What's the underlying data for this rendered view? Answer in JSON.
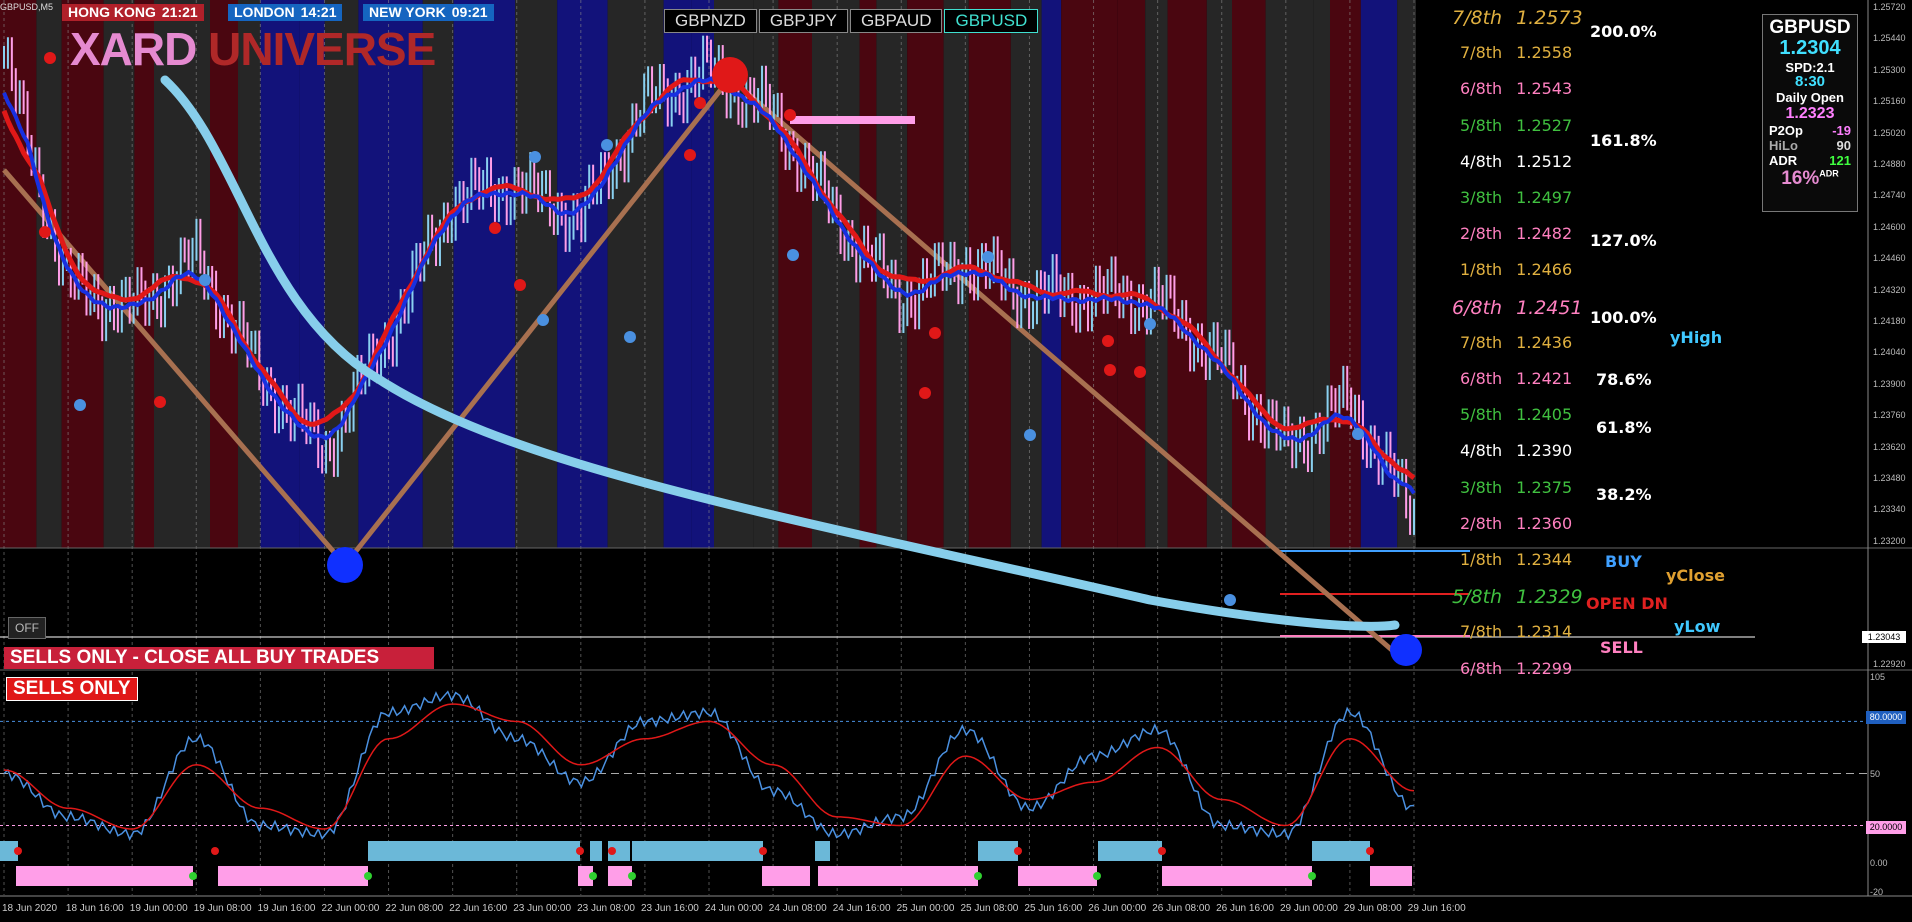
{
  "chart_symbol": "GBPUSD,M5",
  "sessions": [
    {
      "name": "HONG KONG",
      "time": "21:21",
      "bg": "#b0202a"
    },
    {
      "name": "LONDON",
      "time": "14:21",
      "bg": "#1565c0"
    },
    {
      "name": "NEW YORK",
      "time": "09:21",
      "bg": "#1565c0"
    }
  ],
  "logo": {
    "left": "XARD",
    "right": "UNIVERSE"
  },
  "symbol_tabs": [
    {
      "label": "GBPNZD",
      "active": false
    },
    {
      "label": "GBPJPY",
      "active": false
    },
    {
      "label": "GBPAUD",
      "active": false
    },
    {
      "label": "GBPUSD",
      "active": true
    }
  ],
  "info_box": {
    "symbol": "GBPUSD",
    "price": "1.2304",
    "spread": "SPD:2.1",
    "countdown": "8:30",
    "daily_open_label": "Daily Open",
    "daily_open": "1.2323",
    "p2op_label": "P2Op",
    "p2op": "-19",
    "hilo_label": "HiLo",
    "hilo": "90",
    "adr_label": "ADR",
    "adr": "121",
    "adr_pct": "16%",
    "adr_pct_sup": "ADR"
  },
  "murrey_levels": [
    {
      "label": "7/8th",
      "price": "1.2573",
      "color": "#e0b040",
      "italic": true
    },
    {
      "label": "7/8th",
      "price": "1.2558",
      "color": "#e0b040",
      "italic": false
    },
    {
      "label": "6/8th",
      "price": "1.2543",
      "color": "#ff80c0",
      "italic": false
    },
    {
      "label": "5/8th",
      "price": "1.2527",
      "color": "#40c040",
      "italic": false
    },
    {
      "label": "4/8th",
      "price": "1.2512",
      "color": "#ffffff",
      "italic": false
    },
    {
      "label": "3/8th",
      "price": "1.2497",
      "color": "#40c040",
      "italic": false
    },
    {
      "label": "2/8th",
      "price": "1.2482",
      "color": "#ff80c0",
      "italic": false
    },
    {
      "label": "1/8th",
      "price": "1.2466",
      "color": "#e0b040",
      "italic": false
    },
    {
      "label": "6/8th",
      "price": "1.2451",
      "color": "#ff80c0",
      "italic": true
    },
    {
      "label": "7/8th",
      "price": "1.2436",
      "color": "#e0b040",
      "italic": false
    },
    {
      "label": "6/8th",
      "price": "1.2421",
      "color": "#ff80c0",
      "italic": false
    },
    {
      "label": "5/8th",
      "price": "1.2405",
      "color": "#40c040",
      "italic": false
    },
    {
      "label": "4/8th",
      "price": "1.2390",
      "color": "#ffffff",
      "italic": false
    },
    {
      "label": "3/8th",
      "price": "1.2375",
      "color": "#40c040",
      "italic": false
    },
    {
      "label": "2/8th",
      "price": "1.2360",
      "color": "#ff80c0",
      "italic": false
    },
    {
      "label": "1/8th",
      "price": "1.2344",
      "color": "#e0b040",
      "italic": false
    },
    {
      "label": "5/8th",
      "price": "1.2329",
      "color": "#40c040",
      "italic": true
    },
    {
      "label": "7/8th",
      "price": "1.2314",
      "color": "#e0b040",
      "italic": false
    },
    {
      "label": "6/8th",
      "price": "1.2299",
      "color": "#ff80c0",
      "italic": false
    }
  ],
  "fib_levels": [
    "200.0%",
    "161.8%",
    "127.0%",
    "100.0%",
    "78.6%",
    "61.8%",
    "38.2%"
  ],
  "markers": {
    "yhigh": "yHigh",
    "buy": "BUY",
    "yclose": "yClose",
    "open_dn": "OPEN DN",
    "ylow": "yLow",
    "sell": "SELL"
  },
  "off_button": "OFF",
  "banners": {
    "main": "SELLS ONLY - CLOSE ALL BUY TRADES",
    "sub": "SELLS ONLY"
  },
  "price_axis": [
    "1.25720",
    "1.25440",
    "1.25300",
    "1.25160",
    "1.25020",
    "1.24880",
    "1.24740",
    "1.24600",
    "1.24460",
    "1.24320",
    "1.24180",
    "1.24040",
    "1.23900",
    "1.23760",
    "1.23620",
    "1.23480",
    "1.23340",
    "1.23200",
    "1.23043",
    "1.22920"
  ],
  "current_price_tag": "1.23043",
  "indicator_axis": {
    "top": "105",
    "level80": "80.0000",
    "mid": "50",
    "level20": "20.0000",
    "zero": "0.00",
    "bottom": "-20"
  },
  "time_axis": [
    "18 Jun 2020",
    "18 Jun 16:00",
    "19 Jun 00:00",
    "19 Jun 08:00",
    "19 Jun 16:00",
    "22 Jun 00:00",
    "22 Jun 08:00",
    "22 Jun 16:00",
    "23 Jun 00:00",
    "23 Jun 08:00",
    "23 Jun 16:00",
    "24 Jun 00:00",
    "24 Jun 08:00",
    "24 Jun 16:00",
    "25 Jun 00:00",
    "25 Jun 08:00",
    "25 Jun 16:00",
    "26 Jun 00:00",
    "26 Jun 08:00",
    "26 Jun 16:00",
    "29 Jun 00:00",
    "29 Jun 08:00",
    "29 Jun 16:00"
  ],
  "colors": {
    "up_band": "#12127a",
    "down_band": "#4a0610",
    "neutral_band": "#262626",
    "red_ma": "#e01818",
    "blue_ma": "#1830e0",
    "trend_line": "#a87050",
    "long_ma": "#87ceeb",
    "stoch_blue": "#4a90e0",
    "stoch_red": "#e01818",
    "bar_sky": "#6bb8d8",
    "bar_pink": "#ff9ee8"
  },
  "chart_data": {
    "type": "line",
    "x": [
      "18 Jun 2020",
      "18 Jun 16:00",
      "19 Jun 00:00",
      "19 Jun 08:00",
      "19 Jun 16:00",
      "22 Jun 00:00",
      "22 Jun 08:00",
      "22 Jun 16:00",
      "23 Jun 00:00",
      "23 Jun 08:00",
      "23 Jun 16:00",
      "24 Jun 00:00",
      "24 Jun 08:00",
      "24 Jun 16:00",
      "25 Jun 00:00",
      "25 Jun 08:00",
      "25 Jun 16:00",
      "26 Jun 00:00",
      "26 Jun 08:00",
      "26 Jun 16:00",
      "29 Jun 00:00",
      "29 Jun 08:00",
      "29 Jun 16:00"
    ],
    "series": [
      {
        "name": "price",
        "values": [
          1.2545,
          1.2425,
          1.2412,
          1.244,
          1.2378,
          1.2338,
          1.24,
          1.247,
          1.2478,
          1.246,
          1.252,
          1.2538,
          1.2515,
          1.246,
          1.2418,
          1.2438,
          1.242,
          1.242,
          1.2418,
          1.2385,
          1.234,
          1.2365,
          1.2304
        ]
      },
      {
        "name": "stoch_main",
        "values": [
          50,
          25,
          15,
          70,
          20,
          15,
          85,
          95,
          70,
          45,
          80,
          85,
          40,
          15,
          25,
          75,
          30,
          60,
          75,
          20,
          15,
          85,
          30
        ]
      },
      {
        "name": "stoch_signal",
        "values": [
          52,
          30,
          18,
          55,
          30,
          18,
          70,
          90,
          80,
          55,
          70,
          80,
          55,
          25,
          20,
          60,
          35,
          45,
          65,
          35,
          20,
          70,
          40
        ]
      }
    ],
    "ylim_price": [
      1.2288,
      1.2575
    ],
    "ylim_indicator": [
      -20,
      105
    ]
  }
}
